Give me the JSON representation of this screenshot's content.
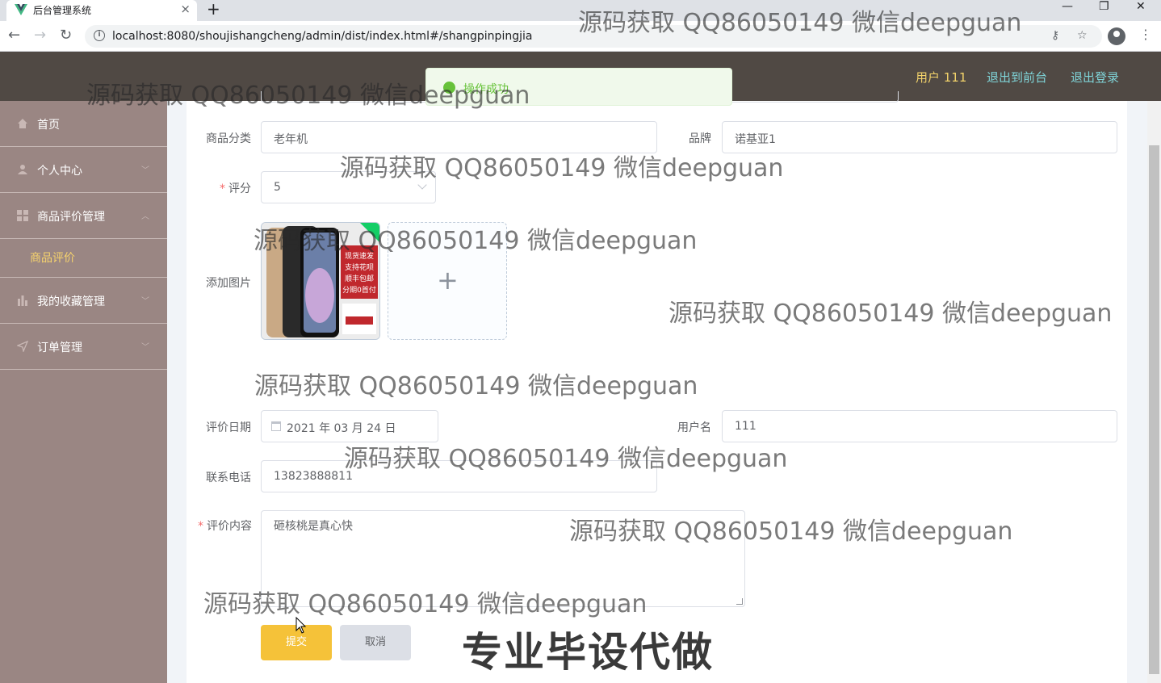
{
  "browser": {
    "tab_title": "后台管理系统",
    "new_tab": "+",
    "url": "localhost:8080/shoujishangcheng/admin/dist/index.html#/shangpinpingjia",
    "window_minimize": "—",
    "window_restore": "❐",
    "window_close": "✕"
  },
  "header": {
    "user_label": "用户 111",
    "to_frontend": "退出到前台",
    "logout": "退出登录"
  },
  "toast": {
    "message": "操作成功"
  },
  "sidebar": {
    "items": [
      {
        "label": "首页"
      },
      {
        "label": "个人中心"
      },
      {
        "label": "商品评价管理"
      },
      {
        "label": "我的收藏管理"
      },
      {
        "label": "订单管理"
      }
    ],
    "sub_item": "商品评价"
  },
  "form": {
    "category": {
      "label": "商品分类",
      "value": "老年机"
    },
    "brand": {
      "label": "品牌",
      "value": "诺基亚1"
    },
    "score": {
      "label": "评分",
      "value": "5"
    },
    "image": {
      "label": "添加图片",
      "plus": "+"
    },
    "review_date": {
      "label": "评价日期",
      "value": "2021 年 03 月 24 日"
    },
    "username": {
      "label": "用户名",
      "value": "111"
    },
    "phone": {
      "label": "联系电话",
      "value": "13823888811"
    },
    "content": {
      "label": "评价内容",
      "value": "砸核桃是真心快"
    },
    "submit": "提交",
    "cancel": "取消"
  },
  "watermarks": {
    "text": "源码获取 QQ86050149 微信deepguan",
    "banner": "专业毕设代做"
  },
  "colors": {
    "header_bg": "#504944",
    "sidebar_bg": "#9a8683",
    "accent_yellow": "#f5c239",
    "link_teal": "#7fd4d8",
    "success_green": "#67c23a"
  }
}
